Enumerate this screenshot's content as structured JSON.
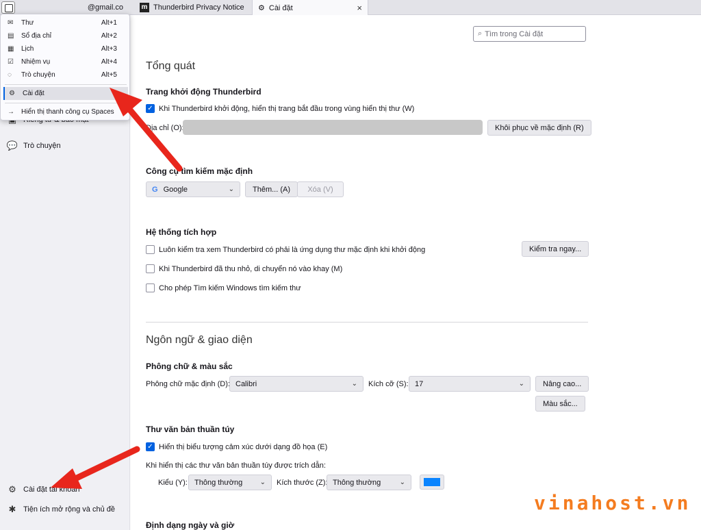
{
  "tabs": {
    "mail_account": "@gmail.co",
    "privacy": "Thunderbird Privacy Notice",
    "settings": "Cài đặt",
    "close": "×"
  },
  "menu": {
    "items": [
      {
        "label": "Thư",
        "shortcut": "Alt+1",
        "icon": "mail-icon"
      },
      {
        "label": "Sổ địa chỉ",
        "shortcut": "Alt+2",
        "icon": "address-book-icon"
      },
      {
        "label": "Lịch",
        "shortcut": "Alt+3",
        "icon": "calendar-icon"
      },
      {
        "label": "Nhiệm vụ",
        "shortcut": "Alt+4",
        "icon": "tasks-icon"
      },
      {
        "label": "Trò chuyện",
        "shortcut": "Alt+5",
        "icon": "chat-icon"
      }
    ],
    "settings": "Cài đặt",
    "show_spaces": "Hiển thị thanh công cụ Spaces"
  },
  "sidebar": {
    "privacy_partial": "Riêng tư & bảo mật",
    "chat": "Trò chuyện",
    "account_settings": "Cài đặt tài khoản",
    "addons": "Tiện ích mở rộng và chủ đề"
  },
  "search": {
    "placeholder": "Tìm trong Cài đặt"
  },
  "general": {
    "title": "Tổng quát",
    "startup_heading": "Trang khởi động Thunderbird",
    "startup_checkbox": "Khi Thunderbird khởi động, hiển thị trang bắt đầu trong vùng hiển thị thư (W)",
    "address_label": "Địa chỉ (O):",
    "restore_default": "Khôi phục về mặc định (R)",
    "search_engine_heading": "Công cụ tìm kiếm mặc định",
    "search_engine_value": "Google",
    "add_button": "Thêm... (A)",
    "remove_button": "Xóa (V)",
    "integration_heading": "Hệ thống tích hợp",
    "check_default": "Luôn kiểm tra xem Thunderbird có phải là ứng dụng thư mặc định khi khởi động",
    "check_now": "Kiểm tra ngay...",
    "minimize_tray": "Khi Thunderbird đã thu nhỏ, di chuyển nó vào khay (M)",
    "windows_search": "Cho phép Tìm kiếm Windows tìm kiếm thư"
  },
  "language": {
    "title": "Ngôn ngữ & giao diện",
    "fonts_heading": "Phông chữ & màu sắc",
    "default_font_label": "Phông chữ mặc định (D):",
    "default_font_value": "Calibri",
    "size_label": "Kích cỡ (S):",
    "size_value": "17",
    "advanced": "Nâng cao...",
    "colors": "Màu sắc...",
    "plaintext_heading": "Thư văn bản thuần túy",
    "emoticons": "Hiển thị biểu tượng cảm xúc dưới dạng đồ họa (E)",
    "quoted_label": "Khi hiển thị các thư văn bản thuần túy được trích dẫn:",
    "style_label": "Kiểu (Y):",
    "style_value": "Thông thường",
    "quoted_size_label": "Kích thước (Z):",
    "quoted_size_value": "Thông thường",
    "datetime_heading": "Định dạng ngày và giờ"
  },
  "watermark": "vinahost.vn",
  "colors": {
    "accent": "#0061e0",
    "arrow": "#e8261c",
    "swatch": "#0a84ff"
  }
}
